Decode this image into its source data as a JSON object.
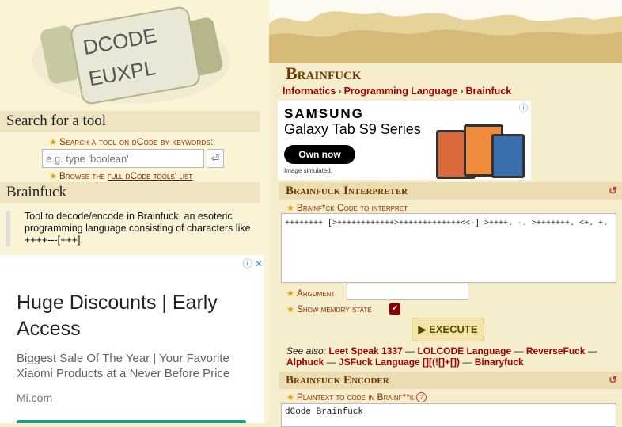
{
  "logo": {
    "letters_top": "DCODE",
    "letters_bottom": "EUXPL"
  },
  "search": {
    "heading": "Search for a tool",
    "label": "Search a tool on dCode by keywords:",
    "placeholder": "e.g. type 'boolean'",
    "button_glyph": "⏎",
    "browse_prefix": "Browse the ",
    "browse_link": "full dCode tools' list"
  },
  "tool": {
    "heading": "Brainfuck",
    "description": "Tool to decode/encode in Brainfuck, an esoteric programming language consisting of characters like ++++---[+++]."
  },
  "ad_left": {
    "title": "Huge Discounts | Early Access",
    "body": "Biggest Sale Of The Year | Your Favorite Xiaomi Products at a Never Before Price",
    "url": "Mi.com",
    "choice_glyph": "ⓘ ✕"
  },
  "page": {
    "title": "Brainfuck",
    "breadcrumb": [
      "Informatics",
      "Programming Language",
      "Brainfuck"
    ]
  },
  "ad_right": {
    "brand": "SAMSUNG",
    "product": "Galaxy Tab S9 Series",
    "cta": "Own now",
    "note": "Image simulated."
  },
  "interpreter": {
    "heading": "Brainfuck Interpreter",
    "code_label": "Brainf*ck Code to interpret",
    "code_value": "++++++++ [>++++++++++++>+++++++++++++<<-] >++++. -. >+++++++. <+. +.",
    "argument_label": "Argument",
    "memory_label": "Show memory state",
    "memory_checked": true,
    "execute_label": "▶ EXECUTE",
    "see_also_label": "See also:",
    "see_also_links": [
      "Leet Speak 1337",
      "LOLCODE Language",
      "ReverseFuck",
      "Alphuck",
      "JSFuck Language [][(![]+[])",
      "Binaryfuck"
    ]
  },
  "encoder": {
    "heading": "Brainfuck Encoder",
    "plain_label": "Plaintext to code in Brainf**k",
    "plain_value": "dCode Brainfuck"
  },
  "colors": {
    "accent": "#a00000",
    "heading": "#6b3a00",
    "star": "#e0a400"
  }
}
